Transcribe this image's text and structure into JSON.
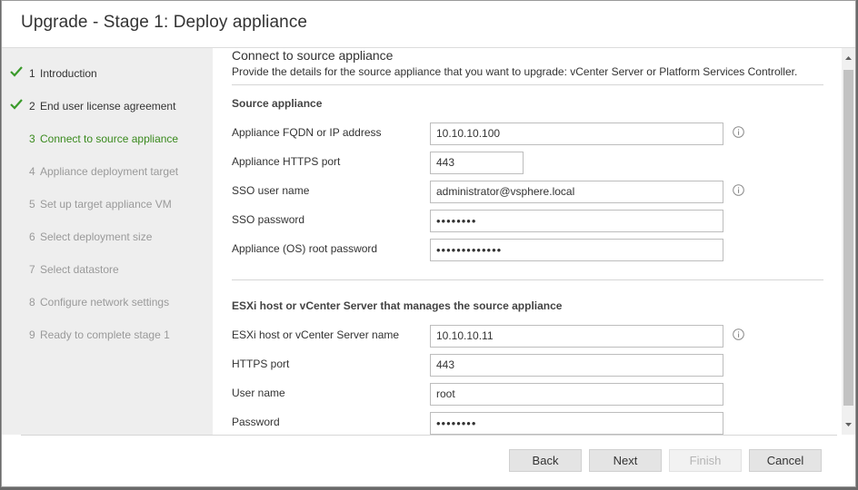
{
  "window": {
    "title": "Upgrade - Stage 1: Deploy appliance"
  },
  "steps": [
    {
      "num": "1",
      "label": "Introduction",
      "state": "done"
    },
    {
      "num": "2",
      "label": "End user license agreement",
      "state": "done"
    },
    {
      "num": "3",
      "label": "Connect to source appliance",
      "state": "current"
    },
    {
      "num": "4",
      "label": "Appliance deployment target",
      "state": "todo"
    },
    {
      "num": "5",
      "label": "Set up target appliance VM",
      "state": "todo"
    },
    {
      "num": "6",
      "label": "Select deployment size",
      "state": "todo"
    },
    {
      "num": "7",
      "label": "Select datastore",
      "state": "todo"
    },
    {
      "num": "8",
      "label": "Configure network settings",
      "state": "todo"
    },
    {
      "num": "9",
      "label": "Ready to complete stage 1",
      "state": "todo"
    }
  ],
  "content": {
    "heading": "Connect to source appliance",
    "description": "Provide the details for the source appliance that you want to upgrade: vCenter Server or Platform Services Controller.",
    "source": {
      "title": "Source appliance",
      "fqdn_label": "Appliance FQDN or IP address",
      "fqdn_value": "10.10.10.100",
      "port_label": "Appliance HTTPS port",
      "port_value": "443",
      "sso_user_label": "SSO user name",
      "sso_user_value": "administrator@vsphere.local",
      "sso_password_label": "SSO password",
      "sso_password_value": "••••••••",
      "root_password_label": "Appliance (OS) root password",
      "root_password_value": "•••••••••••••"
    },
    "host": {
      "title": "ESXi host or vCenter Server that manages the source appliance",
      "name_label": "ESXi host or vCenter Server name",
      "name_value": "10.10.10.11",
      "port_label": "HTTPS port",
      "port_value": "443",
      "user_label": "User name",
      "user_value": "root",
      "password_label": "Password",
      "password_value": "••••••••"
    }
  },
  "buttons": {
    "back": "Back",
    "next": "Next",
    "finish": "Finish",
    "cancel": "Cancel"
  },
  "colors": {
    "current_step": "#3a8a1e",
    "check": "#3a9a2a",
    "sidebar_bg": "#eeeeee"
  }
}
